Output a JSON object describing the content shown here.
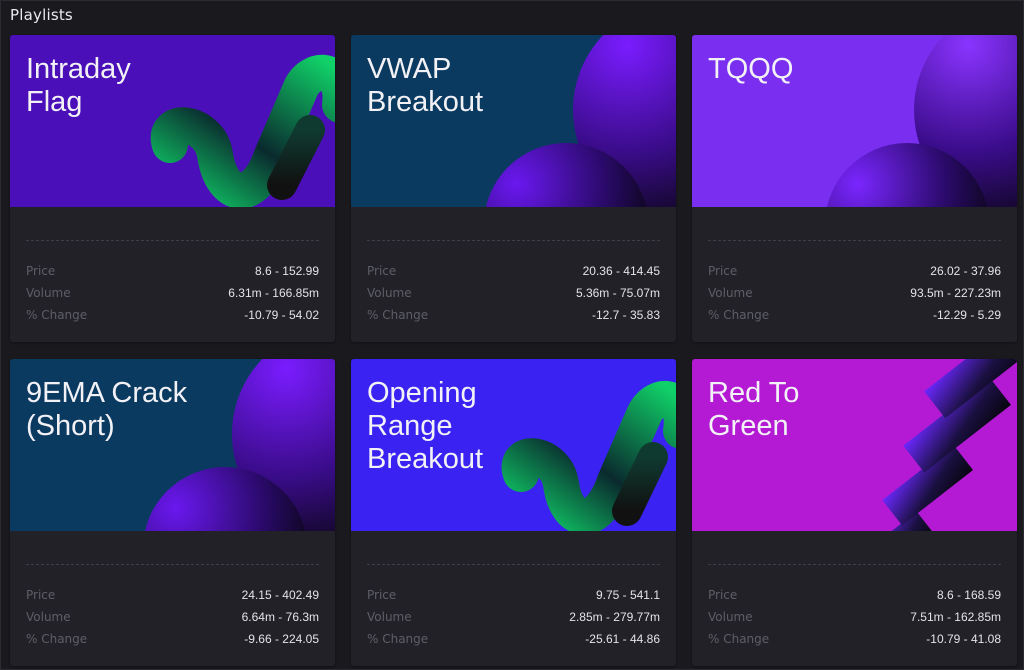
{
  "section": {
    "title": "Playlists"
  },
  "stat_labels": {
    "price": "Price",
    "volume": "Volume",
    "change": "% Change"
  },
  "cards": [
    {
      "title": "Intraday\nFlag",
      "art": "ribbon-icon",
      "bg": "#4a0fb8",
      "price": "8.6 - 152.99",
      "volume": "6.31m - 166.85m",
      "change": "-10.79 - 54.02"
    },
    {
      "title": "VWAP\nBreakout",
      "art": "spheres-icon",
      "bg": "#0b3a60",
      "price": "20.36 - 414.45",
      "volume": "5.36m - 75.07m",
      "change": "-12.7 - 35.83"
    },
    {
      "title": "TQQQ",
      "art": "spheres-icon",
      "bg": "#7a2ff0",
      "price": "26.02 - 37.96",
      "volume": "93.5m - 227.23m",
      "change": "-12.29 - 5.29"
    },
    {
      "title": "9EMA Crack\n(Short)",
      "art": "spheres-icon",
      "bg": "#0b3a60",
      "price": "24.15 - 402.49",
      "volume": "6.64m - 76.3m",
      "change": "-9.66 - 224.05"
    },
    {
      "title": "Opening\nRange\nBreakout",
      "art": "ribbon-icon",
      "bg": "#3a22f2",
      "price": "9.75 - 541.1",
      "volume": "2.85m - 279.77m",
      "change": "-25.61 - 44.86"
    },
    {
      "title": "Red To\nGreen",
      "art": "stairs-icon",
      "bg": "#b41ad4",
      "price": "8.6 - 168.59",
      "volume": "7.51m - 162.85m",
      "change": "-10.79 - 41.08"
    }
  ]
}
